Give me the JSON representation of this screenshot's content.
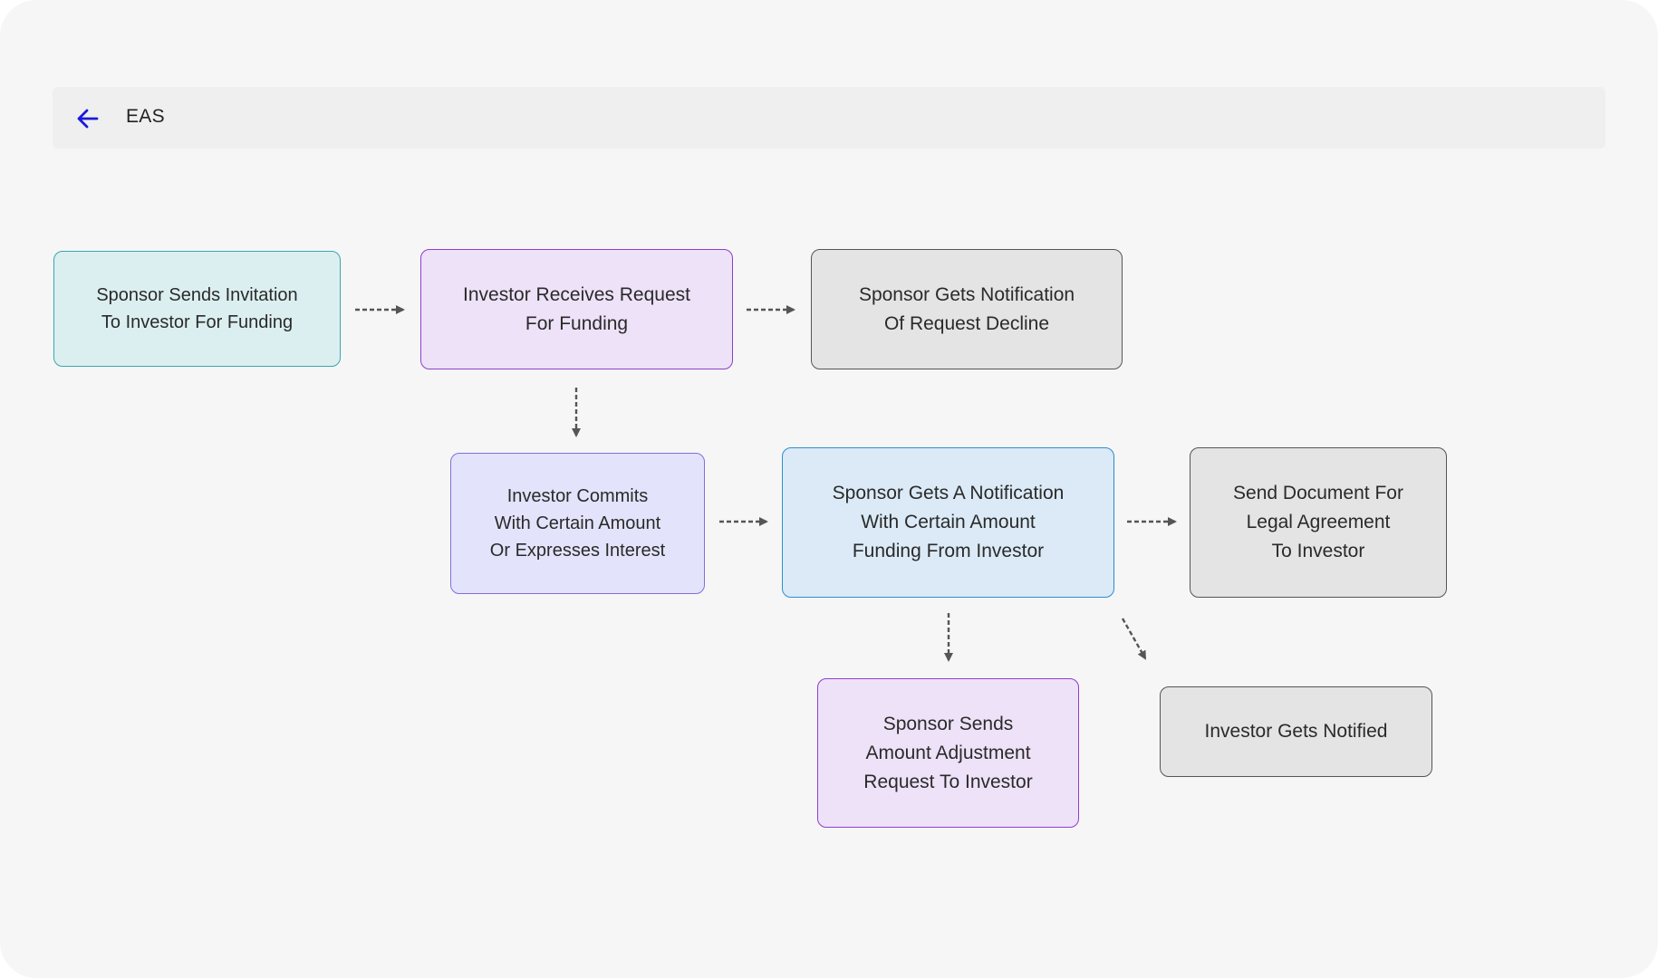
{
  "header": {
    "back_icon": "arrow-left-icon",
    "title": "EAS",
    "accent_color": "#1a1adb"
  },
  "diagram": {
    "nodes": {
      "sponsor_sends_invitation": "Sponsor Sends Invitation\nTo Investor  For Funding",
      "investor_receives_request": "Investor Receives Request\nFor Funding",
      "sponsor_notified_decline": "Sponsor Gets Notification\nOf Request Decline",
      "investor_commits": "Investor Commits\nWith Certain Amount\nOr Expresses Interest",
      "sponsor_notified_amount": "Sponsor Gets A Notification\nWith Certain Amount\nFunding From Investor",
      "send_legal_document": "Send Document For\nLegal Agreement\nTo Investor",
      "sponsor_adjustment_request": "Sponsor Sends\nAmount Adjustment\nRequest To Investor",
      "investor_notified": "Investor Gets Notified"
    },
    "edges": [
      {
        "from": "sponsor_sends_invitation",
        "to": "investor_receives_request",
        "style": "dashed"
      },
      {
        "from": "investor_receives_request",
        "to": "sponsor_notified_decline",
        "style": "dashed"
      },
      {
        "from": "investor_receives_request",
        "to": "investor_commits",
        "style": "dashed"
      },
      {
        "from": "investor_commits",
        "to": "sponsor_notified_amount",
        "style": "dashed"
      },
      {
        "from": "sponsor_notified_amount",
        "to": "send_legal_document",
        "style": "dashed"
      },
      {
        "from": "sponsor_notified_amount",
        "to": "sponsor_adjustment_request",
        "style": "dashed"
      },
      {
        "from": "sponsor_notified_amount",
        "to": "investor_notified",
        "style": "dashed"
      }
    ],
    "colors": {
      "teal_fill": "#dceff0",
      "teal_border": "#3aa7ac",
      "purple_fill": "#ede2f8",
      "purple_border": "#8f3ec9",
      "lavender_fill": "#e3e3fb",
      "lavender_border": "#7f70db",
      "blue_fill": "#dbeaf6",
      "blue_border": "#2b8fcf",
      "gray_fill": "#e4e4e4",
      "gray_border": "#555555",
      "arrow": "#555555"
    }
  }
}
